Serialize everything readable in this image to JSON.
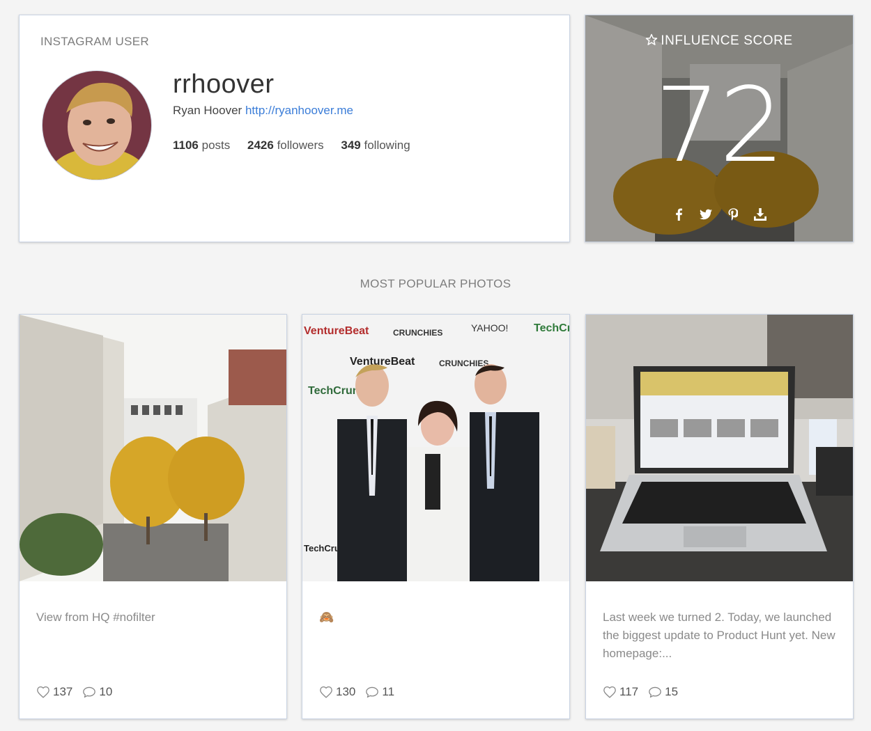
{
  "profile": {
    "section_label": "INSTAGRAM USER",
    "username": "rrhoover",
    "real_name": "Ryan Hoover",
    "website": "http://ryanhoover.me",
    "posts_count": "1106",
    "posts_label": "posts",
    "followers_count": "2426",
    "followers_label": "followers",
    "following_count": "349",
    "following_label": "following"
  },
  "influence": {
    "title": "INFLUENCE SCORE",
    "score": "72",
    "share_icons": [
      "facebook-icon",
      "twitter-icon",
      "pinterest-icon",
      "download-icon"
    ]
  },
  "popular": {
    "title": "MOST POPULAR PHOTOS",
    "photos": [
      {
        "caption": "View from HQ #nofilter",
        "likes": "137",
        "comments": "10"
      },
      {
        "caption": "🙈",
        "likes": "130",
        "comments": "11"
      },
      {
        "caption": "Last week we turned 2. Today, we launched the biggest update to Product Hunt yet. New homepage:...",
        "likes": "117",
        "comments": "15"
      }
    ]
  },
  "photo_brand_text": {
    "venturebeat": "VentureBeat",
    "techcrunch": "TechCrunch",
    "yahoo": "YAHOO!",
    "crunchies": "CRUNCHIES"
  },
  "colors": {
    "link": "#3b7dd8",
    "border": "#c9d3e3",
    "label": "#7d7d7d"
  }
}
